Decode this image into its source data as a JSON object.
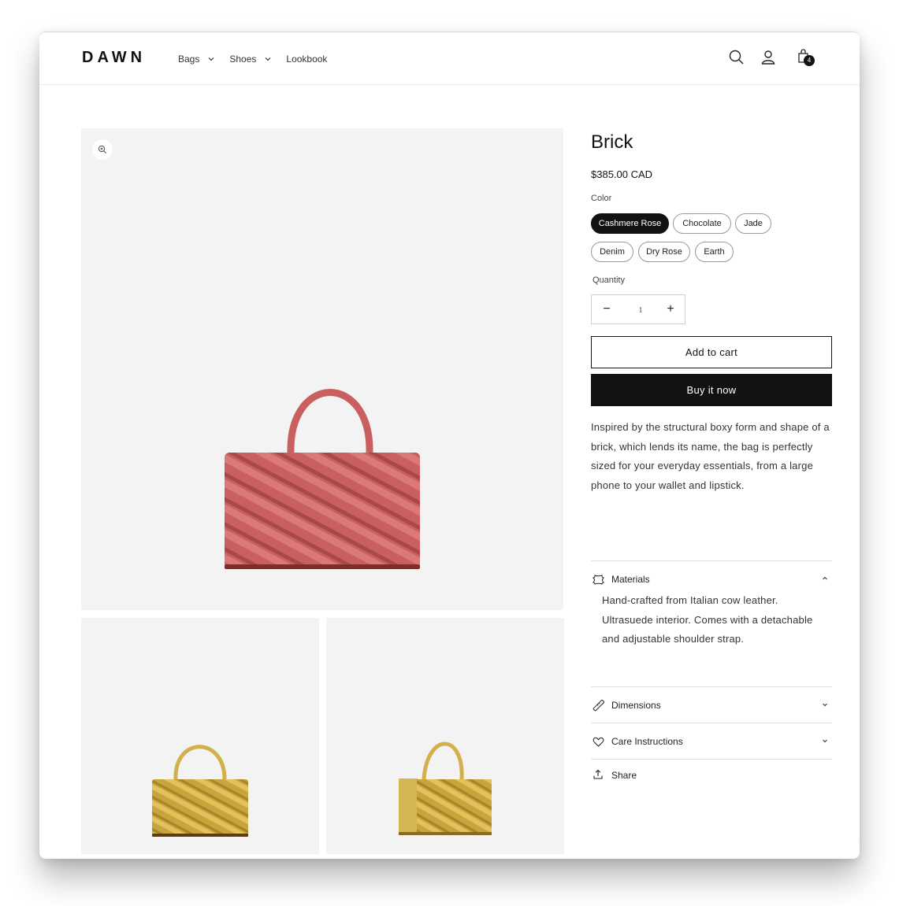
{
  "header": {
    "logo": "DAWN",
    "nav": [
      {
        "label": "Bags",
        "has_dropdown": true
      },
      {
        "label": "Shoes",
        "has_dropdown": true
      },
      {
        "label": "Lookbook",
        "has_dropdown": false
      }
    ],
    "icons": [
      "search-icon",
      "account-icon",
      "cart-icon"
    ],
    "cart_count": "4"
  },
  "gallery": {
    "zoom_icon": "zoom-in-icon",
    "main_image": {
      "alt": "Brick bag in Cashmere Rose, front view",
      "color": "#c9605f"
    },
    "thumbnails": [
      {
        "alt": "Brick bag in mustard, front view",
        "color": "#d2b04a"
      },
      {
        "alt": "Brick bag in mustard, angled view",
        "color": "#d2b04a"
      }
    ]
  },
  "product": {
    "title": "Brick",
    "price": "$385.00 CAD",
    "color_label": "Color",
    "colors": [
      {
        "label": "Cashmere Rose",
        "selected": true
      },
      {
        "label": "Chocolate",
        "selected": false
      },
      {
        "label": "Jade",
        "selected": false
      },
      {
        "label": "Denim",
        "selected": false
      },
      {
        "label": "Dry Rose",
        "selected": false
      },
      {
        "label": "Earth",
        "selected": false
      }
    ],
    "quantity_label": "Quantity",
    "quantity": "1",
    "decrease_symbol": "−",
    "increase_symbol": "+",
    "add_to_cart": "Add to cart",
    "buy_now": "Buy it now",
    "description": "Inspired by the structural boxy form and shape of a brick, which lends its name, the bag is perfectly sized for your everyday essentials, from a large phone to your wallet and lipstick."
  },
  "accordions": [
    {
      "icon": "leather-icon",
      "label": "Materials",
      "expanded": true,
      "content": "Hand-crafted from Italian cow leather. Ultrasuede interior. Comes with a detachable and adjustable shoulder strap."
    },
    {
      "icon": "ruler-icon",
      "label": "Dimensions",
      "expanded": false
    },
    {
      "icon": "heart-icon",
      "label": "Care Instructions",
      "expanded": false
    }
  ],
  "share": {
    "icon": "share-icon",
    "label": "Share"
  },
  "colors": {
    "primary": "#121212",
    "image_bg": "#f3f3f3",
    "border": "#e0e0e0"
  }
}
